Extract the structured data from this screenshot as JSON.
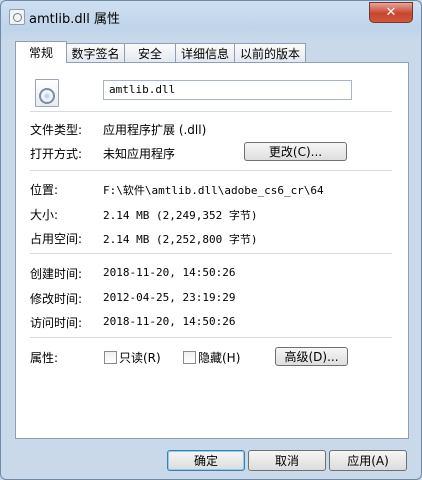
{
  "window": {
    "title": "amtlib.dll 属性",
    "close_label": "✕"
  },
  "tabs": [
    {
      "label": "常规",
      "active": true
    },
    {
      "label": "数字签名",
      "active": false
    },
    {
      "label": "安全",
      "active": false
    },
    {
      "label": "详细信息",
      "active": false
    },
    {
      "label": "以前的版本",
      "active": false
    }
  ],
  "general": {
    "file_name": "amtlib.dll",
    "file_type_label": "文件类型:",
    "file_type_value": "应用程序扩展 (.dll)",
    "opens_with_label": "打开方式:",
    "opens_with_value": "未知应用程序",
    "change_button": "更改(C)...",
    "location_label": "位置:",
    "location_value": "F:\\软件\\amtlib.dll\\adobe_cs6_cr\\64",
    "size_label": "大小:",
    "size_value": "2.14 MB (2,249,352 字节)",
    "size_on_disk_label": "占用空间:",
    "size_on_disk_value": "2.14 MB (2,252,800 字节)",
    "created_label": "创建时间:",
    "created_value": "2018-11-20, 14:50:26",
    "modified_label": "修改时间:",
    "modified_value": "2012-04-25, 23:19:29",
    "accessed_label": "访问时间:",
    "accessed_value": "2018-11-20, 14:50:26",
    "attributes_label": "属性:",
    "readonly_label": "只读(R)",
    "readonly_checked": false,
    "hidden_label": "隐藏(H)",
    "hidden_checked": false,
    "advanced_button": "高级(D)..."
  },
  "footer": {
    "ok_button": "确定",
    "cancel_button": "取消",
    "apply_button": "应用(A)"
  }
}
